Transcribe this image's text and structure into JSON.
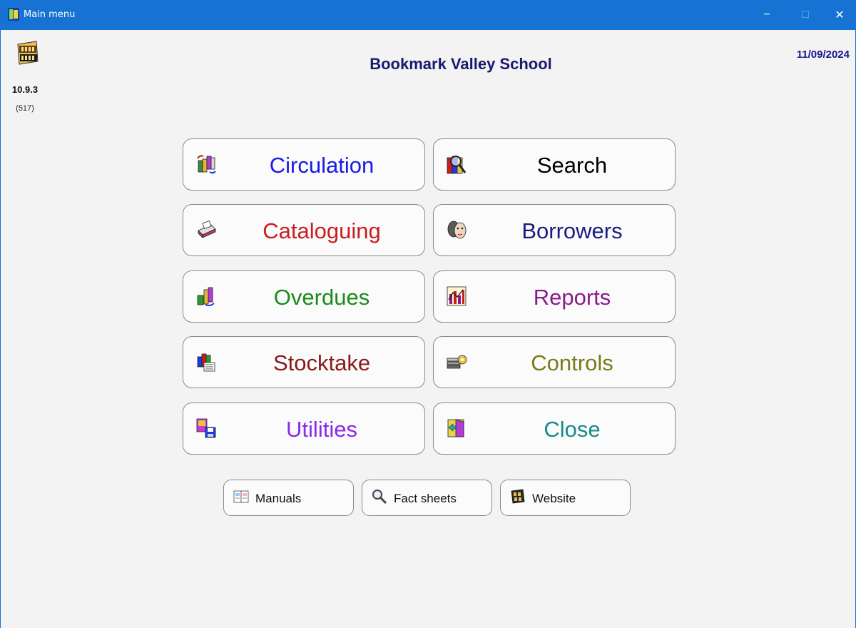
{
  "window": {
    "title": "Main menu",
    "minimize_glyph": "−",
    "maximize_glyph": "□",
    "close_glyph": "✕"
  },
  "header": {
    "version": "10.9.3",
    "build": "(517)",
    "school_name": "Bookmark Valley School",
    "date": "11/09/2024"
  },
  "menu": {
    "circulation": {
      "label": "Circulation",
      "color": "#1a1ae6",
      "icon": "books-circulation-icon"
    },
    "search": {
      "label": "Search",
      "color": "#000000",
      "icon": "magnifier-books-icon"
    },
    "cataloguing": {
      "label": "Cataloguing",
      "color": "#c81e1e",
      "icon": "card-catalogue-icon"
    },
    "borrowers": {
      "label": "Borrowers",
      "color": "#1a1a80",
      "icon": "people-faces-icon"
    },
    "overdues": {
      "label": "Overdues",
      "color": "#1a8a1a",
      "icon": "books-overdue-icon"
    },
    "reports": {
      "label": "Reports",
      "color": "#8a1a8a",
      "icon": "bar-chart-icon"
    },
    "stocktake": {
      "label": "Stocktake",
      "color": "#8a1a1a",
      "icon": "books-stack-icon"
    },
    "controls": {
      "label": "Controls",
      "color": "#7a7a1a",
      "icon": "key-icon"
    },
    "utilities": {
      "label": "Utilities",
      "color": "#8a2ae6",
      "icon": "floppy-disk-icon"
    },
    "close": {
      "label": "Close",
      "color": "#1a8a8a",
      "icon": "exit-door-icon"
    }
  },
  "links": {
    "manuals": {
      "label": "Manuals",
      "icon": "manual-icon"
    },
    "fact_sheets": {
      "label": "Fact sheets",
      "icon": "magnifying-glass-icon"
    },
    "website": {
      "label": "Website",
      "icon": "web-logo-icon"
    }
  }
}
